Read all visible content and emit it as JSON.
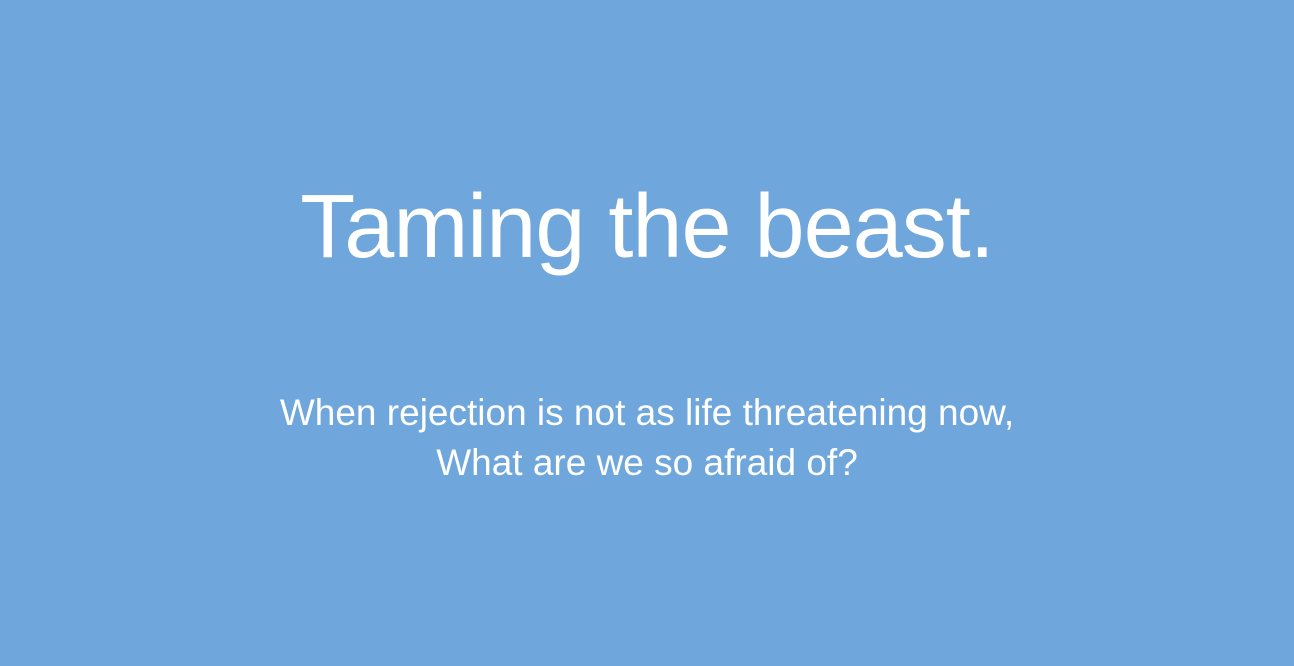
{
  "slide": {
    "background_color": "#6fa7dc",
    "text_color": "#ffffff",
    "title": "Taming the beast.",
    "subtitle_lines": [
      "When rejection is not as life threatening now,",
      "What are we so afraid of?"
    ]
  }
}
